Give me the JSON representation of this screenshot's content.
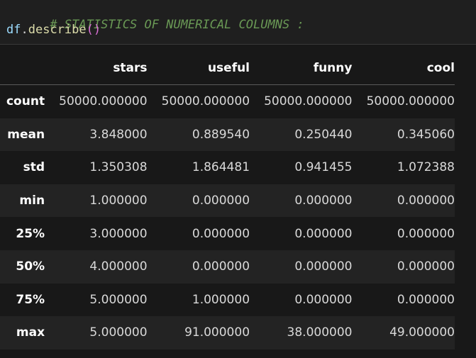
{
  "code": {
    "comment": "# STATISTICS OF NUMERICAL COLUMNS :",
    "var": "df",
    "dot": ".",
    "func": "describe",
    "parens": "()"
  },
  "table": {
    "columns": [
      "stars",
      "useful",
      "funny",
      "cool"
    ],
    "rows": [
      {
        "label": "count",
        "values": [
          "50000.000000",
          "50000.000000",
          "50000.000000",
          "50000.000000"
        ]
      },
      {
        "label": "mean",
        "values": [
          "3.848000",
          "0.889540",
          "0.250440",
          "0.345060"
        ]
      },
      {
        "label": "std",
        "values": [
          "1.350308",
          "1.864481",
          "0.941455",
          "1.072388"
        ]
      },
      {
        "label": "min",
        "values": [
          "1.000000",
          "0.000000",
          "0.000000",
          "0.000000"
        ]
      },
      {
        "label": "25%",
        "values": [
          "3.000000",
          "0.000000",
          "0.000000",
          "0.000000"
        ]
      },
      {
        "label": "50%",
        "values": [
          "4.000000",
          "0.000000",
          "0.000000",
          "0.000000"
        ]
      },
      {
        "label": "75%",
        "values": [
          "5.000000",
          "1.000000",
          "0.000000",
          "0.000000"
        ]
      },
      {
        "label": "max",
        "values": [
          "5.000000",
          "91.000000",
          "38.000000",
          "49.000000"
        ]
      }
    ]
  }
}
